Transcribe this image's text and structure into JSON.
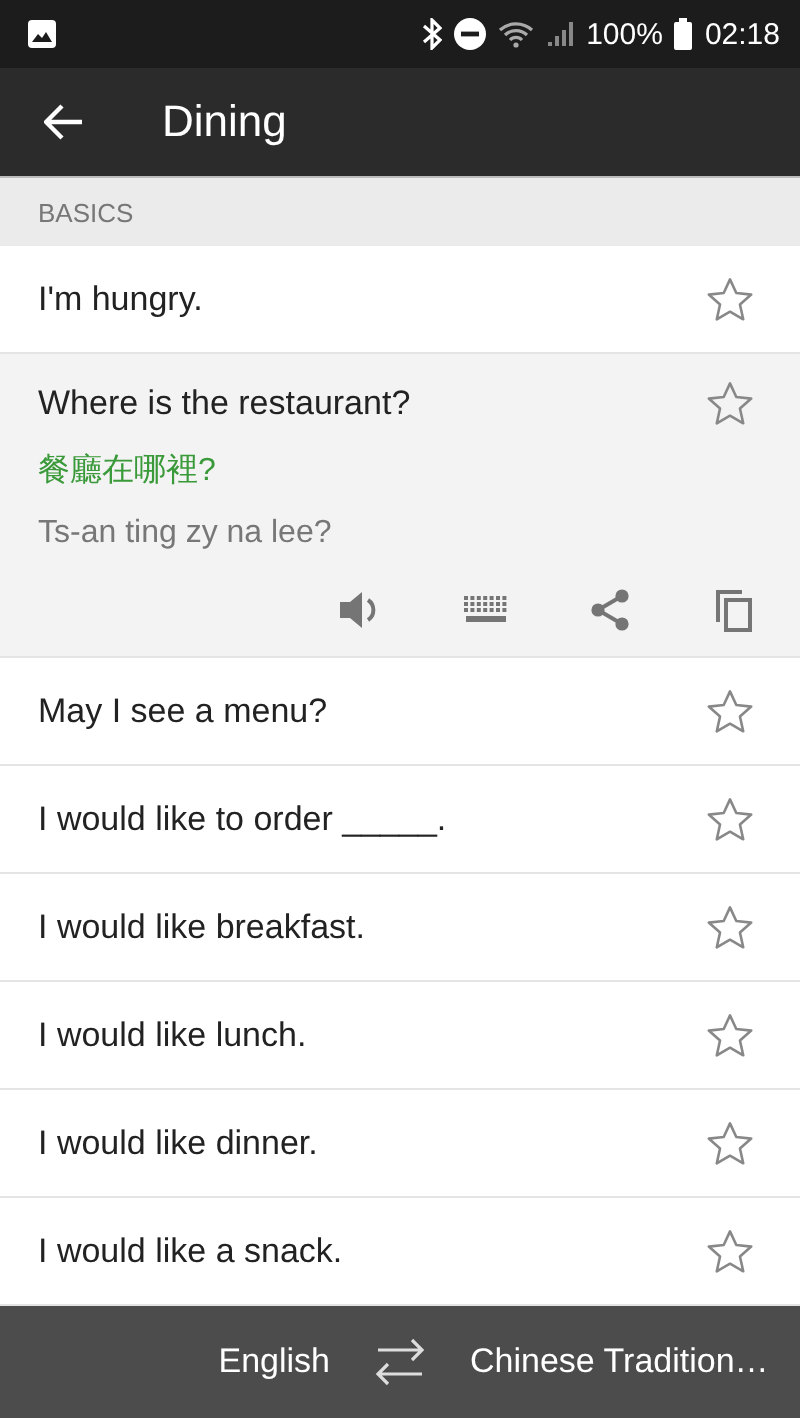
{
  "status_bar": {
    "battery": "100%",
    "time": "02:18"
  },
  "app_bar": {
    "title": "Dining"
  },
  "section": {
    "title": "BASICS"
  },
  "phrases": [
    {
      "text": "I'm hungry.",
      "expanded": false,
      "starred": false
    },
    {
      "text": "Where is the restaurant?",
      "expanded": true,
      "starred": false,
      "translation": "餐廳在哪裡?",
      "romanization": "Ts-an ting zy na lee?"
    },
    {
      "text": "May I see a menu?",
      "expanded": false,
      "starred": false
    },
    {
      "text": "I would like to order _____.",
      "expanded": false,
      "starred": false
    },
    {
      "text": "I would like breakfast.",
      "expanded": false,
      "starred": false
    },
    {
      "text": "I would like lunch.",
      "expanded": false,
      "starred": false
    },
    {
      "text": "I would like dinner.",
      "expanded": false,
      "starred": false
    },
    {
      "text": "I would like a snack.",
      "expanded": false,
      "starred": false
    }
  ],
  "language_bar": {
    "source": "English",
    "target": "Chinese Tradition…"
  }
}
